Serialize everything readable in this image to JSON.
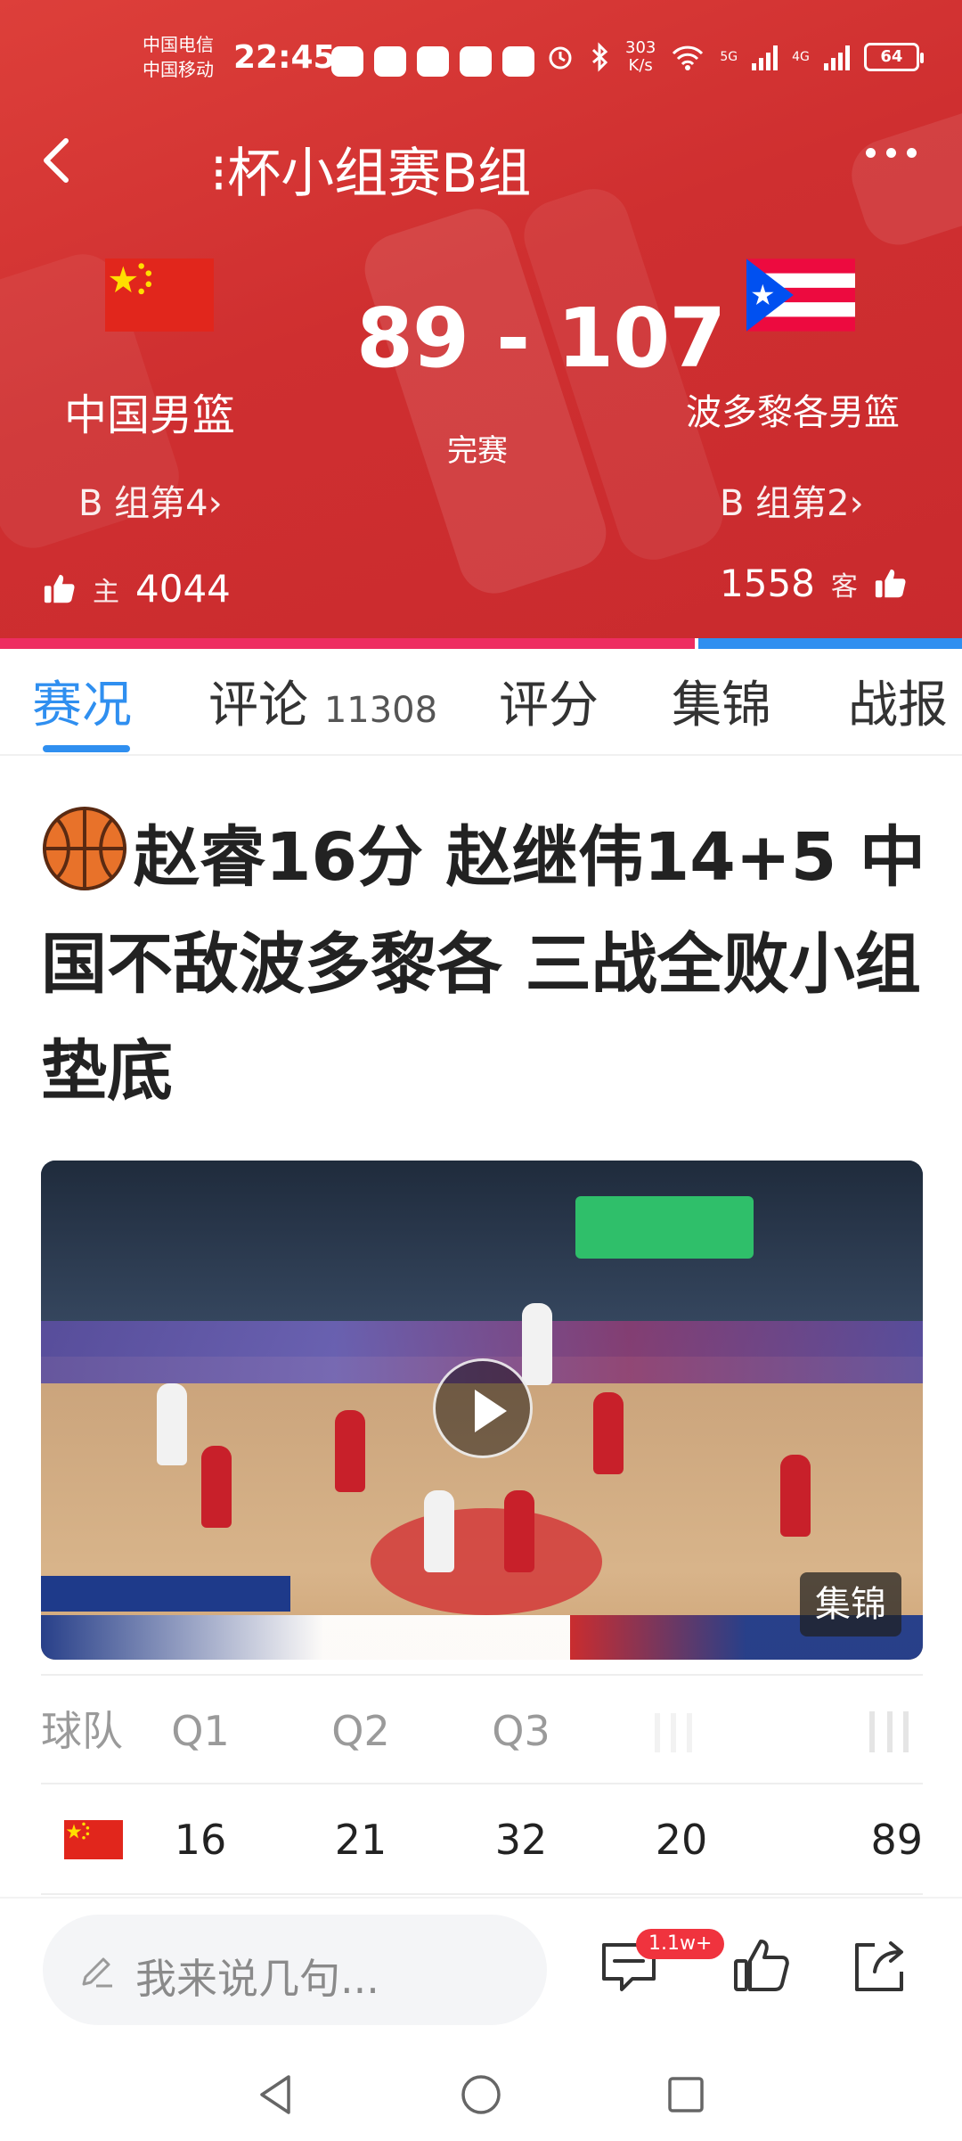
{
  "status_bar": {
    "carrier_1": "中国电信",
    "carrier_2": "中国移动",
    "time": "22:45",
    "net_speed_value": "303",
    "net_speed_unit": "K/s",
    "net_1": "5G",
    "net_2": "4G",
    "battery": "64"
  },
  "nav": {
    "title": "⁝杯小组赛B组"
  },
  "match": {
    "score": "89 - 107",
    "status": "完赛",
    "home": {
      "name": "中国男篮",
      "rank": "B 组第4›",
      "side_label": "主",
      "likes": "4044"
    },
    "away": {
      "name": "波多黎各男篮",
      "rank": "B 组第2›",
      "side_label": "客",
      "likes": "1558"
    },
    "colors": {
      "home_bar": "#ee2d61",
      "away_bar": "#2f8ff0"
    }
  },
  "tabs": [
    {
      "label": "赛况",
      "count": ""
    },
    {
      "label": "评论",
      "count": "11308"
    },
    {
      "label": "评分",
      "count": ""
    },
    {
      "label": "集锦",
      "count": ""
    },
    {
      "label": "战报",
      "count": ""
    }
  ],
  "article": {
    "headline": "赵睿16分 赵继伟14+5 中国不敌波多黎各 三战全败小组垫底",
    "video_tag": "集锦"
  },
  "score_table": {
    "headers": [
      "球队",
      "Q1",
      "Q2",
      "Q3"
    ],
    "rows": [
      {
        "team_icon": "china-flag-icon",
        "q1": "16",
        "q2": "21",
        "q3": "32",
        "q4": "20",
        "total": "89"
      }
    ]
  },
  "bottom_bar": {
    "comment_placeholder": "我来说几句...",
    "comment_badge": "1.1w+"
  },
  "icons": {
    "back": "chevron-left-icon",
    "more": "more-dots-icon",
    "ball": "basketball-icon",
    "play": "play-icon",
    "like": "thumb-up-icon",
    "share": "share-icon",
    "comment": "comment-icon"
  }
}
